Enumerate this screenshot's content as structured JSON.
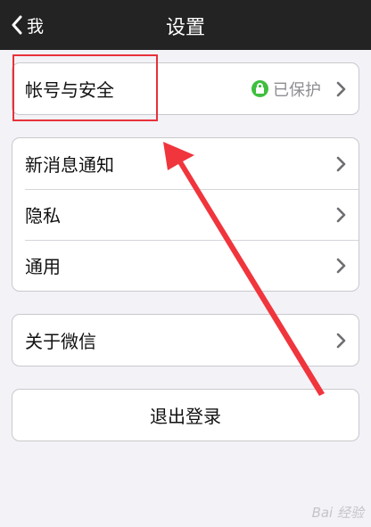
{
  "navbar": {
    "back_label": "我",
    "title": "设置"
  },
  "groups": {
    "account": {
      "label": "帐号与安全",
      "status": "已保护"
    },
    "general": {
      "items": [
        {
          "label": "新消息通知"
        },
        {
          "label": "隐私"
        },
        {
          "label": "通用"
        }
      ]
    },
    "about": {
      "label": "关于微信"
    },
    "logout": {
      "label": "退出登录"
    }
  },
  "watermark": "Bai 经验",
  "colors": {
    "navbar": "#232323",
    "background": "#f2f2f7",
    "lock": "#3ebf3e",
    "annotation": "#e8313a"
  },
  "icons": [
    "chevron-left-icon",
    "lock-icon",
    "chevron-right-icon"
  ]
}
